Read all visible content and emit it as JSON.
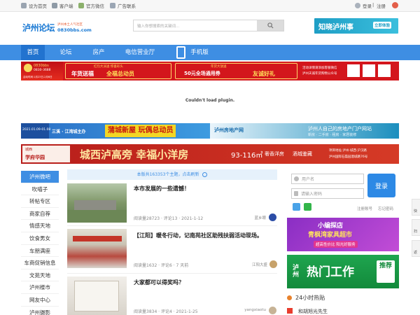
{
  "topbar": {
    "set_home": "设为首页",
    "client": "客户端",
    "wechat": "官方微信",
    "ad_contact": "广告联系",
    "login": "登录",
    "register": "注册",
    "separator": "|"
  },
  "header": {
    "logo_text": "泸州论坛",
    "logo_slogan": "泸州本土人气社区",
    "logo_url": "0830bbs.com",
    "search_placeholder": "输入你想搜索的关键词...",
    "ad_text": "知晓泸州事",
    "ad_button": "立即体验"
  },
  "nav": {
    "items": [
      "首页",
      "论坛",
      "房产",
      "电信营业厅",
      "手机版"
    ]
  },
  "banner1": {
    "left_tag": "0830bbs",
    "left_phone": "0830-3688",
    "left_date": "活动时间:1月23日-2月6日",
    "mid1_top": "红包大派送 惊喜彩头",
    "mid1_main": "年货送福",
    "mid1_main2": "全福总动员",
    "mid2_top": "年货大放送",
    "mid2_main": "50元全场通用券",
    "mid2_main2": "友诚好礼",
    "right_text": "活动详情请添加客服微信",
    "right_text2": "泸州天诚年货购物公众号",
    "colors": {
      "bg": "#d3161c",
      "gold": "#ffde59"
    }
  },
  "plugin_error": "Couldn't load plugin.",
  "banner2": {
    "left_date": "2021.01.09-01.08",
    "left_label": "三溪 · 江湾城主办",
    "main": "蒲城新屋 玩偶总动员",
    "logo": "泸州房地产网",
    "right_text": "泸州人自己的房地产门户网站",
    "right_sub": "新房 · 二手房 · 租房 · 家居装修"
  },
  "banner3": {
    "left_top": "城西",
    "left_brand": "学府华园",
    "main": "城西泸高旁 幸福小洋房",
    "area": "93-116㎡",
    "area_label": "奢香洋房",
    "tag": "酒城鉴藏",
    "address": "项目地址:泸州·城西·沪汉路",
    "phone": "泸州国际石磊园酒城路76号"
  },
  "sidebar": {
    "items": [
      "泸州微吧",
      "吹喵子",
      "转帖专区",
      "商家自荐",
      "情感天地",
      "饮食男女",
      "车朋满座",
      "车商促销信息",
      "文苑天地",
      "泸州楼市",
      "网友中心",
      "泸州摄影"
    ]
  },
  "notice": {
    "text": "本版共163353个主题，点击刷新"
  },
  "posts": [
    {
      "title": "本市发展的一些遗憾！",
      "meta": "阅读量28723 · 评论13 · 2021-1-12",
      "author": "蓝乡眼"
    },
    {
      "title": "【江阳】暖冬行动，记南苑社区助残扶弱活动现场。",
      "meta": "阅读量1632 · 评论6 · 7 天前",
      "author": "江阳大盛"
    },
    {
      "title": "大家都可以得奖吗？",
      "meta": "阅读量3834 · 评论4 · 2021-1-25",
      "author": "yangxiaotu"
    }
  ],
  "login": {
    "user_placeholder": "用户名",
    "pass_placeholder": "请输入密码",
    "button": "登录",
    "register": "注册账号",
    "forgot": "忘记密码"
  },
  "ad_right1": {
    "title": "小编探店",
    "sub": "青枫湾家具超市",
    "tag": "超高性价比 阳光好服务"
  },
  "ad_right2": {
    "city": "泸州",
    "main": "热门工作",
    "badge": "推荐"
  },
  "hot": {
    "title": "24小时热贴",
    "first": "和胡旭光先生"
  },
  "float_tools": [
    "快",
    "扫",
    "返"
  ]
}
